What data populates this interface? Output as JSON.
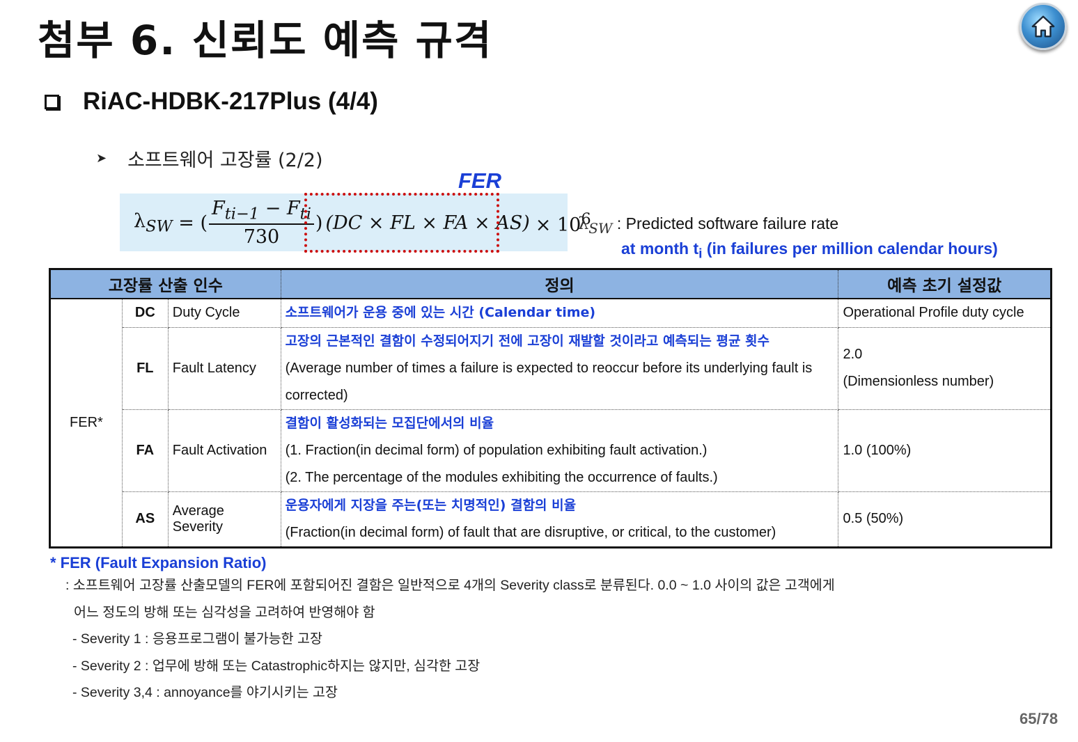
{
  "title": "첨부 6. 신뢰도 예측 규격",
  "section": "RiAC-HDBK-217Plus (4/4)",
  "subsection": "소프트웨어 고장률 (2/2)",
  "fer_label": "FER",
  "formula": {
    "lhs": "λ",
    "lhs_sub": "SW",
    "eq": " = (",
    "numerator": "F",
    "num_sub1": "ti−1",
    "num_minus": " − F",
    "num_sub2": "ti",
    "denominator": "730",
    "close": ")",
    "fer_terms": "(DC × FL × FA × AS)",
    "times": "× 10",
    "exp": "6"
  },
  "lambda_def": {
    "symbol": "λ",
    "symbol_sub": "SW",
    "line1": " : Predicted software failure rate",
    "line2": "at month t",
    "line2_sub": "i",
    "line2_rest": " (in failures per million calendar hours)"
  },
  "table": {
    "headers": [
      "고장률 산출 인수",
      "정의",
      "예측 초기 설정값"
    ],
    "group_label": "FER*",
    "rows": [
      {
        "code": "DC",
        "name": "Duty Cycle",
        "def_kr": "소프트웨어가 운용 중에 있는 시간 (Calendar time)",
        "def_en": [],
        "init": [
          "Operational Profile duty cycle"
        ]
      },
      {
        "code": "FL",
        "name": "Fault Latency",
        "def_kr": "고장의 근본적인 결함이 수정되어지기 전에 고장이 재발할 것이라고 예측되는 평균 횟수",
        "def_en": [
          "(Average number of times a failure is expected to reoccur before its underlying fault is",
          "corrected)"
        ],
        "init": [
          "2.0",
          "(Dimensionless number)"
        ]
      },
      {
        "code": "FA",
        "name": "Fault Activation",
        "def_kr": "결함이 활성화되는 모집단에서의 비율",
        "def_en": [
          "(1. Fraction(in decimal form) of population exhibiting fault activation.)",
          "(2. The percentage of the modules exhibiting the occurrence of faults.)"
        ],
        "init": [
          "1.0 (100%)"
        ]
      },
      {
        "code": "AS",
        "name": "Average Severity",
        "def_kr": "운용자에게 지장을 주는(또는 치명적인) 결함의 비율",
        "def_en": [
          "(Fraction(in decimal form) of fault that are disruptive, or critical, to the customer)"
        ],
        "init": [
          "0.5 (50%)"
        ]
      }
    ]
  },
  "notes": {
    "head": "* FER (Fault Expansion Ratio)",
    "lines": [
      ": 소프트웨어 고장률 산출모델의 FER에 포함되어진 결함은 일반적으로 4개의 Severity class로 분류된다. 0.0 ~ 1.0 사이의 값은 고객에게",
      "어느 정도의 방해 또는 심각성을 고려하여 반영해야 함",
      "- Severity 1 : 응용프로그램이 불가능한 고장",
      "- Severity 2 : 업무에 방해 또는 Catastrophic하지는 않지만, 심각한 고장",
      "- Severity 3,4 : annoyance를 야기시키는 고장"
    ]
  },
  "page": "65/78",
  "icons": {
    "home": "home-icon",
    "bullet": "square-bullet-icon",
    "arrow": "arrowhead-bullet-icon"
  },
  "colors": {
    "blue_text": "#1a3fd6",
    "header_bg": "#8db3e2",
    "formula_bg": "#dbeef9",
    "fer_box": "#cc1010"
  }
}
